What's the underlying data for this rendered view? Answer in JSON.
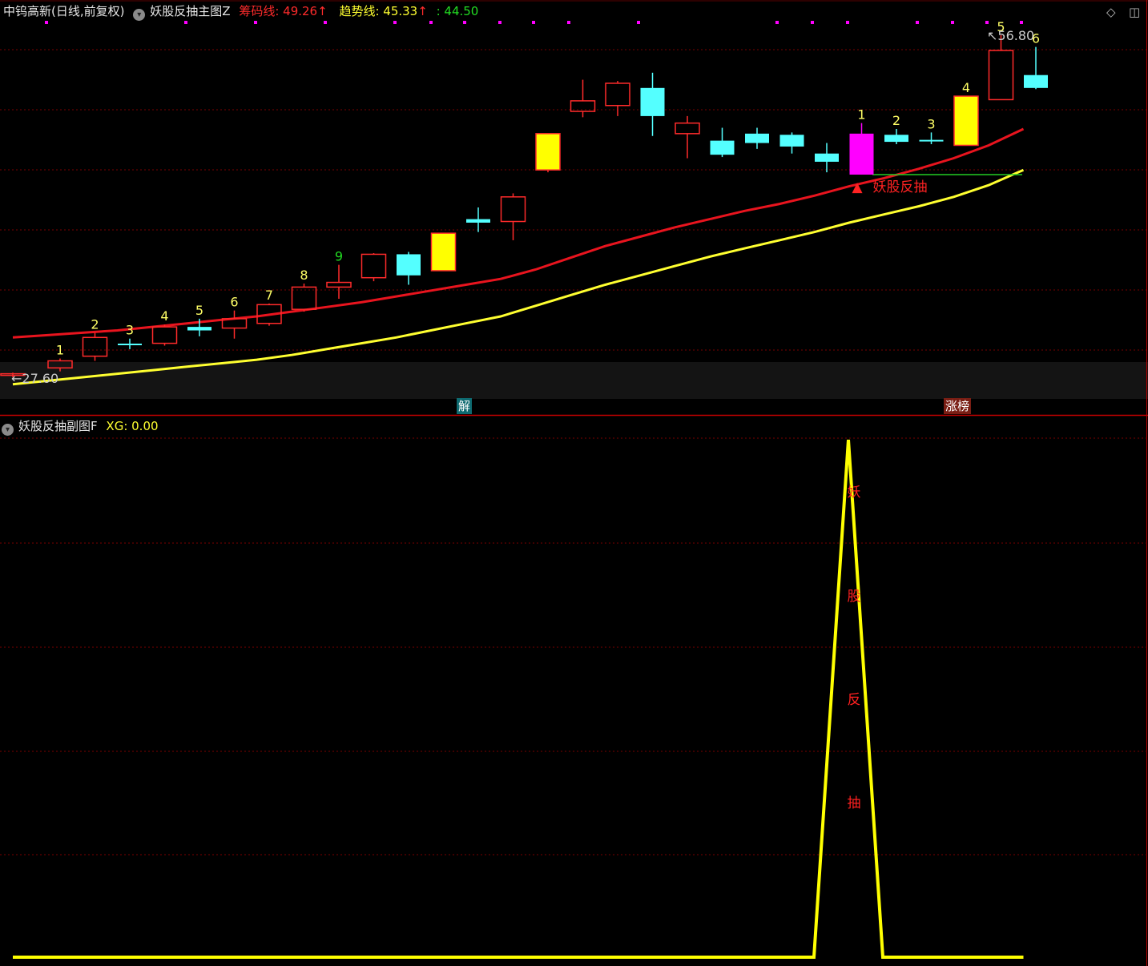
{
  "main_header": {
    "stock": "中钨高新(日线,前复权)",
    "indicator": "妖股反抽主图Z",
    "chip_label": "筹码线: 49.26",
    "chip_arrow": "↑",
    "trend_label": "趋势线: 45.33",
    "trend_arrow": "↑",
    "extra_value": ": 44.50"
  },
  "sub_header": {
    "indicator": "妖股反抽副图F",
    "xg_label": "XG: 0.00"
  },
  "controls": {
    "diamond": "◇",
    "window": "◫"
  },
  "colors": {
    "bull": "#ff2b2b",
    "bear": "#54ffff",
    "limit_up": "#ffff00",
    "magenta": "#ff00ff",
    "ma_red": "#e8141e",
    "ma_yellow": "#ffff30",
    "grid": "#7a0000",
    "panel_border": "#c40000"
  },
  "event_labels": {
    "jie": "解",
    "zhangbang": "涨榜"
  },
  "price_markers": {
    "low": "27.60",
    "high": "56.80",
    "low_arrow": "←",
    "high_arrow": "↖"
  },
  "signal": {
    "marker": "▲",
    "text": "妖股反抽"
  },
  "sub_signal_chars": [
    "妖",
    "股",
    "反",
    "抽"
  ],
  "chart_data": [
    {
      "type": "candlestick",
      "title": "妖股反抽主图Z",
      "y_range": [
        27.0,
        58.5
      ],
      "candles": [
        {
          "o": 27.9,
          "h": 28.0,
          "l": 27.6,
          "c": 27.9,
          "kind": "bull",
          "tag": ""
        },
        {
          "o": 28.4,
          "h": 29.2,
          "l": 28.1,
          "c": 29.0,
          "kind": "bull",
          "tag": "1"
        },
        {
          "o": 29.4,
          "h": 31.4,
          "l": 29.0,
          "c": 31.0,
          "kind": "bull",
          "tag": "2"
        },
        {
          "o": 30.4,
          "h": 30.9,
          "l": 30.0,
          "c": 30.4,
          "kind": "cross",
          "tag": "3"
        },
        {
          "o": 30.5,
          "h": 32.1,
          "l": 30.3,
          "c": 31.9,
          "kind": "bull",
          "tag": "4"
        },
        {
          "o": 31.9,
          "h": 32.6,
          "l": 31.1,
          "c": 31.6,
          "kind": "bear",
          "tag": "5"
        },
        {
          "o": 31.8,
          "h": 33.3,
          "l": 30.9,
          "c": 32.6,
          "kind": "bull",
          "tag": "6"
        },
        {
          "o": 32.2,
          "h": 33.9,
          "l": 32.0,
          "c": 33.8,
          "kind": "bull",
          "tag": "7"
        },
        {
          "o": 33.4,
          "h": 35.6,
          "l": 33.2,
          "c": 35.3,
          "kind": "bull",
          "tag": "8"
        },
        {
          "o": 35.3,
          "h": 37.2,
          "l": 34.3,
          "c": 35.7,
          "kind": "bull",
          "tag": "9"
        },
        {
          "o": 36.1,
          "h": 38.2,
          "l": 35.8,
          "c": 38.1,
          "kind": "bull",
          "tag": ""
        },
        {
          "o": 38.1,
          "h": 38.3,
          "l": 35.5,
          "c": 36.3,
          "kind": "bear",
          "tag": ""
        },
        {
          "o": 36.7,
          "h": 39.9,
          "l": 36.7,
          "c": 39.9,
          "kind": "limit",
          "tag": ""
        },
        {
          "o": 41.1,
          "h": 42.1,
          "l": 40.0,
          "c": 40.8,
          "kind": "bear",
          "tag": ""
        },
        {
          "o": 40.9,
          "h": 43.3,
          "l": 39.3,
          "c": 43.0,
          "kind": "bull",
          "tag": ""
        },
        {
          "o": 45.3,
          "h": 48.4,
          "l": 45.1,
          "c": 48.4,
          "kind": "limit",
          "tag": ""
        },
        {
          "o": 50.3,
          "h": 53.0,
          "l": 49.8,
          "c": 51.2,
          "kind": "bull",
          "tag": ""
        },
        {
          "o": 50.8,
          "h": 52.9,
          "l": 49.9,
          "c": 52.7,
          "kind": "bull",
          "tag": ""
        },
        {
          "o": 52.3,
          "h": 53.6,
          "l": 48.2,
          "c": 49.9,
          "kind": "bear",
          "tag": ""
        },
        {
          "o": 48.4,
          "h": 49.9,
          "l": 46.3,
          "c": 49.3,
          "kind": "bull",
          "tag": ""
        },
        {
          "o": 47.8,
          "h": 48.9,
          "l": 46.4,
          "c": 46.6,
          "kind": "bear",
          "tag": ""
        },
        {
          "o": 48.4,
          "h": 48.9,
          "l": 47.1,
          "c": 47.6,
          "kind": "bear",
          "tag": ""
        },
        {
          "o": 48.3,
          "h": 48.5,
          "l": 46.7,
          "c": 47.3,
          "kind": "bear",
          "tag": ""
        },
        {
          "o": 46.7,
          "h": 47.6,
          "l": 45.1,
          "c": 46.0,
          "kind": "bear",
          "tag": ""
        },
        {
          "o": 48.4,
          "h": 49.3,
          "l": 44.9,
          "c": 44.9,
          "kind": "magenta",
          "tag": "1"
        },
        {
          "o": 48.3,
          "h": 48.8,
          "l": 47.5,
          "c": 47.7,
          "kind": "bear",
          "tag": "2"
        },
        {
          "o": 47.8,
          "h": 48.5,
          "l": 47.5,
          "c": 47.8,
          "kind": "cross",
          "tag": "3"
        },
        {
          "o": 47.4,
          "h": 51.6,
          "l": 47.4,
          "c": 51.6,
          "kind": "limit",
          "tag": "4"
        },
        {
          "o": 51.3,
          "h": 56.8,
          "l": 51.3,
          "c": 55.5,
          "kind": "bull",
          "tag": "5"
        },
        {
          "o": 53.4,
          "h": 55.8,
          "l": 52.2,
          "c": 52.3,
          "kind": "bear",
          "tag": "6"
        }
      ],
      "series": [
        {
          "name": "筹码线",
          "color": "#e8141e",
          "values": [
            31.0,
            31.2,
            31.4,
            31.6,
            31.9,
            32.2,
            32.5,
            32.8,
            33.2,
            33.6,
            34.0,
            34.5,
            35.0,
            35.5,
            36.0,
            36.8,
            37.8,
            38.8,
            39.6,
            40.4,
            41.1,
            41.8,
            42.4,
            43.1,
            43.9,
            44.6,
            45.4,
            46.3,
            47.4,
            48.8
          ]
        },
        {
          "name": "趋势线",
          "color": "#ffff30",
          "values": [
            27.0,
            27.3,
            27.6,
            27.9,
            28.2,
            28.5,
            28.8,
            29.1,
            29.5,
            30.0,
            30.5,
            31.0,
            31.6,
            32.2,
            32.8,
            33.7,
            34.6,
            35.5,
            36.3,
            37.1,
            37.9,
            38.6,
            39.3,
            40.0,
            40.8,
            41.5,
            42.2,
            43.0,
            44.0,
            45.3
          ]
        }
      ],
      "signal_level": 44.9
    },
    {
      "type": "line",
      "title": "妖股反抽副图F",
      "y_range": [
        0,
        1
      ],
      "series": [
        {
          "name": "XG",
          "color": "#ffff00",
          "values": [
            0,
            0,
            0,
            0,
            0,
            0,
            0,
            0,
            0,
            0,
            0,
            0,
            0,
            0,
            0,
            0,
            0,
            0,
            0,
            0,
            0,
            0,
            0,
            0,
            1,
            0,
            0,
            0,
            0,
            0
          ]
        }
      ]
    }
  ]
}
